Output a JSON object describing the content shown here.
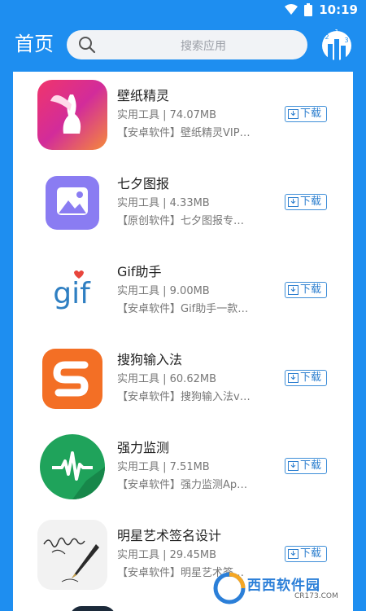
{
  "status_bar": {
    "time": "10:19",
    "icons": [
      "wifi-icon",
      "battery-icon"
    ]
  },
  "header": {
    "title": "首页",
    "search_placeholder": "搜索应用",
    "manager_badges": [
      "1",
      "2",
      "3"
    ]
  },
  "colors": {
    "brand": "#1e8ef0",
    "download_border": "#3e8ed8",
    "download_text": "#2d7fcf"
  },
  "apps": [
    {
      "name": "壁纸精灵",
      "meta": "实用工具 | 74.07MB",
      "desc": "【安卓软件】壁纸精灵VIP…",
      "download": "下载",
      "icon": "wallpaper-fairy-icon"
    },
    {
      "name": "七夕图报",
      "meta": "实用工具 | 4.33MB",
      "desc": "【原创软件】七夕图报专…",
      "download": "下载",
      "icon": "image-icon"
    },
    {
      "name": "Gif助手",
      "meta": "实用工具 | 9.00MB",
      "desc": "【安卓软件】Gif助手一款…",
      "download": "下载",
      "icon": "gif-icon"
    },
    {
      "name": "搜狗输入法",
      "meta": "实用工具 | 60.62MB",
      "desc": "【安卓软件】搜狗输入法v…",
      "download": "下载",
      "icon": "sogou-icon"
    },
    {
      "name": "强力监测",
      "meta": "实用工具 | 7.51MB",
      "desc": "【安卓软件】强力监测Ap…",
      "download": "下载",
      "icon": "heartbeat-icon"
    },
    {
      "name": "明星艺术签名设计",
      "meta": "实用工具 | 29.45MB",
      "desc": "【安卓软件】明星艺术签…",
      "download": "下载",
      "icon": "signature-pen-icon"
    }
  ],
  "watermark": {
    "text": "西西软件园",
    "sub": "CR173.COM"
  }
}
